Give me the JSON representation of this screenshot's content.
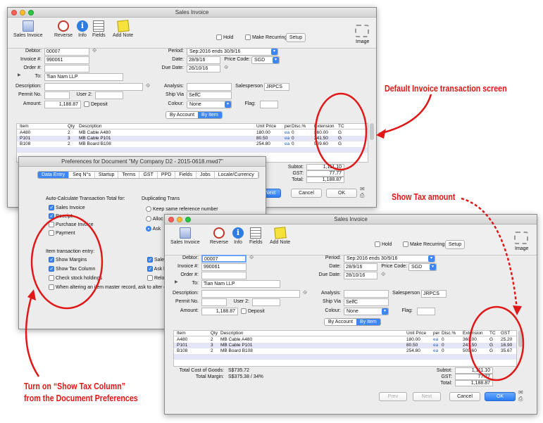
{
  "toolbar": {
    "sales_invoice": "Sales Invoice",
    "reverse": "Reverse",
    "info": "Info",
    "fields": "Fields",
    "add_note": "Add Note",
    "hold": "Hold",
    "make_recurring": "Make Recurring",
    "setup": "Setup",
    "image": "Image"
  },
  "win1": {
    "title": "Sales Invoice",
    "labels": {
      "debtor": "Debtor:",
      "invoice": "Invoice #:",
      "order": "Order #:",
      "to": "To:",
      "description": "Description:",
      "permit": "Permit No.",
      "user2": "User 2:",
      "amount": "Amount:",
      "deposit": "Deposit",
      "period": "Period:",
      "date": "Date:",
      "price_code": "Price Code:",
      "due_date": "Due Date:",
      "analysis": "Analysis:",
      "salesperson": "Salesperson",
      "ship_via": "Ship Via",
      "colour": "Colour:",
      "flag": "Flag:"
    },
    "values": {
      "debtor": "00007",
      "invoice": "990061",
      "to": "Tian Nam LLP",
      "amount": "1,188.87",
      "period": "Sep:2016 ends 30/9/16",
      "date": "28/9/16",
      "price_code": "SGD",
      "due_date": "26/10/16",
      "salesperson": "JRPCS",
      "ship_via": "SelfC",
      "colour": "None"
    },
    "seg": [
      "By Account",
      "By Item"
    ],
    "cols": [
      "Item",
      "Qty",
      "Description",
      "Unit Price",
      "per",
      "Disc.%",
      "Extension",
      "TC"
    ],
    "rows": [
      [
        "A480",
        "2",
        "MB Cable A480",
        "180.00",
        "ea",
        "0",
        "360.00",
        "G"
      ],
      [
        "P101",
        "3",
        "MB Cable P101",
        "80.50",
        "ea",
        "0",
        "241.50",
        "G"
      ],
      [
        "B108",
        "2",
        "MB Board B108",
        "254.80",
        "ea",
        "0",
        "509.60",
        "G"
      ]
    ],
    "subtot_label": "Subtot:",
    "subtot": "1,111.10",
    "gst_label": "GST:",
    "gst": "77.77",
    "total_label": "Total:",
    "total": "1,188.87",
    "next": "Next",
    "cancel": "Cancel",
    "ok": "OK"
  },
  "prefs": {
    "title": "Preferences for Document \"My Company D2 - 2015-0618.mwd7\"",
    "tabs": [
      "Data Entry",
      "Seq N°s",
      "Startup",
      "Terms",
      "GST",
      "PPD",
      "Fields",
      "Jobs",
      "Locale/Currency"
    ],
    "auto_calc_heading": "Auto-Calculate Transaction Total for:",
    "auto_calc": [
      {
        "label": "Sales Invoice",
        "on": true
      },
      {
        "label": "Receipt",
        "on": true
      },
      {
        "label": "Purchase Invoice",
        "on": false
      },
      {
        "label": "Payment",
        "on": false
      }
    ],
    "dup_heading": "Duplicating Trans",
    "dup_opts": [
      {
        "label": "Keep same reference number",
        "on": false
      },
      {
        "label": "Alloc",
        "on": false
      },
      {
        "label": "Ask",
        "on": true
      }
    ],
    "item_heading": "Item transaction entry:",
    "item_opts": [
      {
        "label": "Show Margins",
        "on": true
      },
      {
        "label": "Show Tax Column",
        "on": true
      },
      {
        "label": "Check stock holdings",
        "on": false
      },
      {
        "label": "When altering an item master record, ask to alter existing",
        "on": false
      }
    ],
    "right_opts": [
      {
        "label": "Sales",
        "on": true
      },
      {
        "label": "Ask b",
        "on": true
      },
      {
        "label": "Reloc",
        "on": false
      }
    ]
  },
  "win2": {
    "title": "Sales Invoice",
    "values": {
      "debtor": "00007",
      "invoice": "990061",
      "to": "Tian Nam LLP",
      "amount": "1,188.87",
      "period": "Sep:2016 ends 30/9/16",
      "date": "28/9/16",
      "price_code": "SGD",
      "due_date": "28/10/16",
      "salesperson": "JRPCS",
      "ship_via": "SelfC",
      "colour": "None"
    },
    "cols": [
      "Item",
      "Qty",
      "Description",
      "Unit Price",
      "per",
      "Disc.%",
      "Extension",
      "TC",
      "GST"
    ],
    "rows": [
      [
        "A480",
        "2",
        "MB Cable A480",
        "180.00",
        "ea",
        "0",
        "360.00",
        "G",
        "25.20"
      ],
      [
        "P101",
        "3",
        "MB Cable P101",
        "80.50",
        "ea",
        "0",
        "241.50",
        "G",
        "16.90"
      ],
      [
        "B108",
        "2",
        "MB Board B108",
        "254.80",
        "ea",
        "0",
        "509.60",
        "G",
        "35.67"
      ]
    ],
    "cost_label": "Total Cost of Goods:",
    "cost": "S$735.72",
    "margin_label": "Total Margin:",
    "margin": "S$375.38 / 34%",
    "subtot": "1,111.10",
    "gst": "77.77",
    "total": "1,188.87",
    "prev": "Prev",
    "next": "Next",
    "cancel": "Cancel",
    "ok": "OK"
  },
  "callouts": {
    "default_screen": "Default Invoice transaction screen",
    "show_tax": "Show Tax amount",
    "turn_on_1": "Turn on “Show Tax Column”",
    "turn_on_2": "from the Document Preferences"
  },
  "colors": {
    "annotation_red": "#e01818",
    "accent_blue": "#3d86f5",
    "row_alt": "#e4e6f7"
  }
}
